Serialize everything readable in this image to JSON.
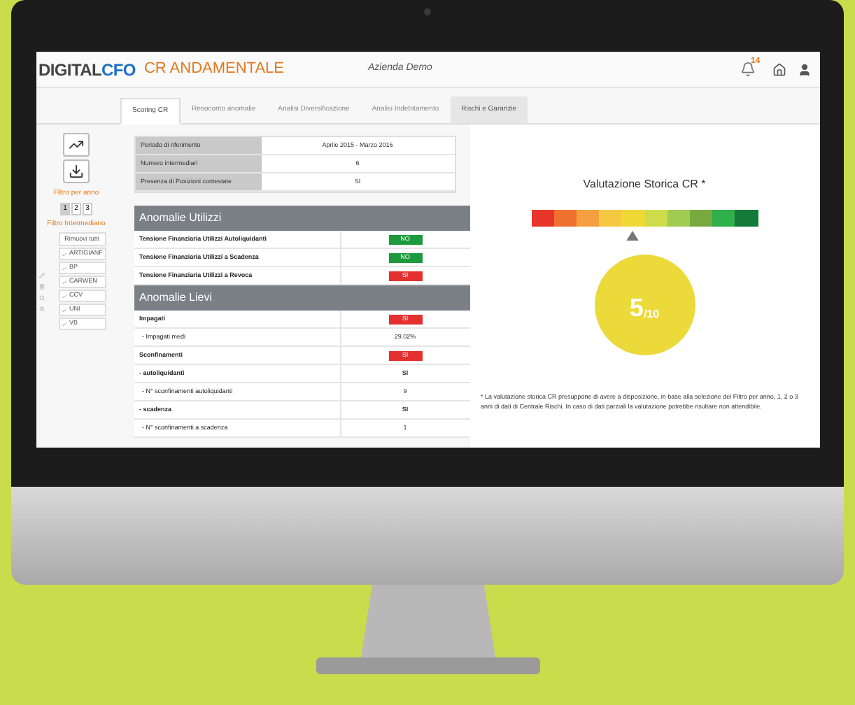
{
  "header": {
    "logo_left": "DIGITAL",
    "logo_right": "CFO",
    "module": "CR ANDAMENTALE",
    "company": "Azienda Demo",
    "notifications": "14"
  },
  "tabs": [
    {
      "label": "Scoring CR",
      "selected": true,
      "hovered": false
    },
    {
      "label": "Resoconto anomalie",
      "selected": false,
      "hovered": false
    },
    {
      "label": "Analisi Diversificazione",
      "selected": false,
      "hovered": false
    },
    {
      "label": "Analisi Indebitamento",
      "selected": false,
      "hovered": false
    },
    {
      "label": "Rischi e Garanzie",
      "selected": false,
      "hovered": true
    }
  ],
  "sidebar": {
    "filter_year_label": "Filtro per anno",
    "years": [
      {
        "label": "1",
        "selected": true
      },
      {
        "label": "2",
        "selected": false
      },
      {
        "label": "3",
        "selected": false
      }
    ],
    "filter_intermediary_label": "Filtro Intermediario",
    "remove_all": "Rimuovi tutti",
    "intermediaries": [
      {
        "label": "ARTIGIANF",
        "checked": true
      },
      {
        "label": "BP",
        "checked": true
      },
      {
        "label": "CARWEN",
        "checked": true
      },
      {
        "label": "CCV",
        "checked": true
      },
      {
        "label": "UNI",
        "checked": true
      },
      {
        "label": "VB",
        "checked": true
      }
    ]
  },
  "info_table": [
    {
      "label": "Periodo di riferimento",
      "value": "Aprile 2015 - Marzo 2016"
    },
    {
      "label": "Numero intermediari",
      "value": "6"
    },
    {
      "label": "Presenza di Posizioni contestate",
      "value": "SI"
    }
  ],
  "sections": [
    {
      "title": "Anomalie Utilizzi",
      "rows": [
        {
          "label": "Tensione Finanziaria Utilizzi Autoliquidanti",
          "kind": "badge",
          "value": "NO",
          "alert": false,
          "bold": true
        },
        {
          "label": "Tensione Finanziaria Utilizzi a Scadenza",
          "kind": "badge",
          "value": "NO",
          "alert": false,
          "bold": true
        },
        {
          "label": "Tensione Finanziaria Utilizzi a Revoca",
          "kind": "badge",
          "value": "SI",
          "alert": true,
          "bold": true
        }
      ]
    },
    {
      "title": "Anomalie Lievi",
      "rows": [
        {
          "label": "Impagati",
          "kind": "badge",
          "value": "SI",
          "alert": true,
          "bold": true
        },
        {
          "label": "- Impagati medi",
          "kind": "text",
          "value": "29.02%",
          "bold": false
        },
        {
          "label": "Sconfinamenti",
          "kind": "badge",
          "value": "SI",
          "alert": true,
          "bold": true
        },
        {
          "label": "- autoliquidanti",
          "kind": "text",
          "value": "SI",
          "bold": true
        },
        {
          "label": "- N° sconfinamenti autoliquidanti",
          "kind": "text",
          "value": "9",
          "bold": false
        },
        {
          "label": "- scadenza",
          "kind": "text",
          "value": "SI",
          "bold": true
        },
        {
          "label": "- N° sconfinamenti a scadenza",
          "kind": "text",
          "value": "1",
          "bold": false
        }
      ]
    }
  ],
  "rating": {
    "title": "Valutazione Storica CR *",
    "scale": [
      {
        "color": "#e8372a"
      },
      {
        "color": "#f07030"
      },
      {
        "color": "#f5a040"
      },
      {
        "color": "#f5c842"
      },
      {
        "color": "#efd935"
      },
      {
        "color": "#cfdc4a"
      },
      {
        "color": "#9fcb50"
      },
      {
        "color": "#78a840"
      },
      {
        "color": "#2fb04a"
      },
      {
        "color": "#147a3a"
      }
    ],
    "level": 0.45,
    "score": "5",
    "score_max": "/10",
    "footnote": "* La valutazione storica CR presuppone di avere a disposizione, in base alla selezione del Filtro per anno, 1, 2 o 3 anni di dati di Centrale Rischi. In caso di dati parziali la valutazione potrebbe risultare non attendibile."
  }
}
